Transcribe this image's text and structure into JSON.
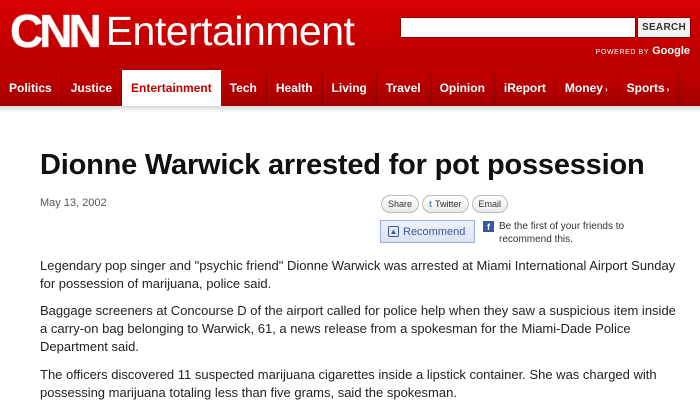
{
  "header": {
    "logo_text": "CNN",
    "section_title": "Entertainment",
    "search_placeholder": "",
    "search_button": "SEARCH",
    "powered_by": "POWERED BY",
    "powered_brand": "Google"
  },
  "nav": {
    "items": [
      {
        "label": "Politics",
        "arrow": ""
      },
      {
        "label": "Justice",
        "arrow": ""
      },
      {
        "label": "Entertainment",
        "arrow": ""
      },
      {
        "label": "Tech",
        "arrow": ""
      },
      {
        "label": "Health",
        "arrow": ""
      },
      {
        "label": "Living",
        "arrow": ""
      },
      {
        "label": "Travel",
        "arrow": ""
      },
      {
        "label": "Opinion",
        "arrow": ""
      },
      {
        "label": "iReport",
        "arrow": ""
      },
      {
        "label": "Money",
        "arrow": "›"
      },
      {
        "label": "Sports",
        "arrow": "›"
      }
    ],
    "active_index": 2
  },
  "article": {
    "headline": "Dionne Warwick arrested for pot possession",
    "date": "May 13, 2002",
    "share_buttons": [
      "Share",
      "Twitter",
      "Email"
    ],
    "recommend_label": "Recommend",
    "fb_prompt": "Be the first of your friends to recommend this.",
    "paragraphs": [
      "Legendary pop singer and \"psychic friend\" Dionne Warwick was arrested at Miami International Airport Sunday for possession of marijuana, police said.",
      "Baggage screeners at Concourse D of the airport called for police help when they saw a suspicious item inside a carry-on bag belonging to Warwick, 61, a news release from a spokesman for the Miami-Dade Police Department said.",
      "The officers discovered 11 suspected marijuana cigarettes inside a lipstick container. She was charged with possessing marijuana totaling less than five grams, said the spokesman."
    ]
  },
  "colors": {
    "brand_red": "#c00000",
    "facebook_blue": "#3b5998"
  }
}
